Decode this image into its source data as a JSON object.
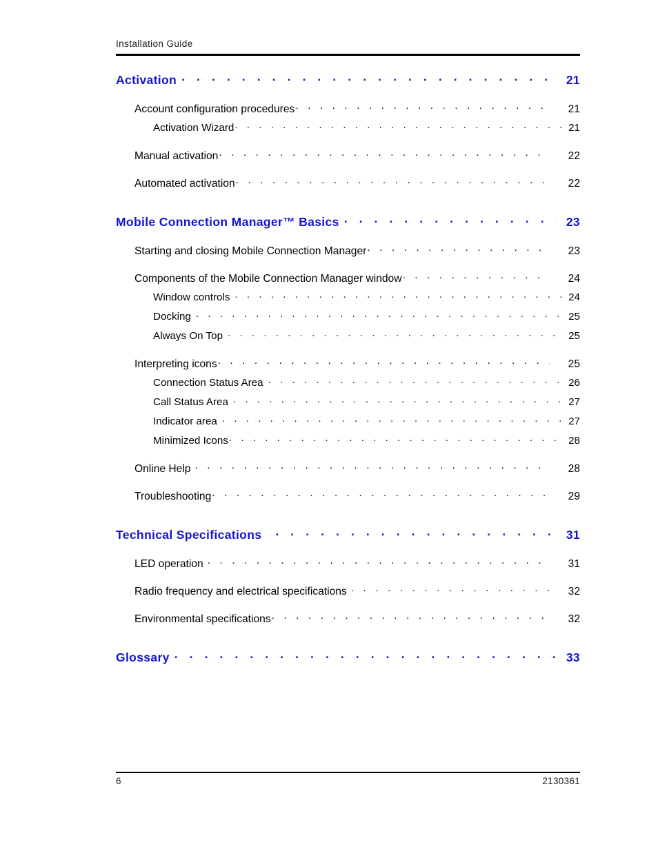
{
  "header": {
    "title": "Installation Guide"
  },
  "footer": {
    "page_number": "6",
    "document_number": "2130361"
  },
  "toc": {
    "sections": [
      {
        "heading": {
          "label": "Activation",
          "page": "21",
          "extra_gap": false
        },
        "entries": [
          {
            "level": 1,
            "label": "Account configuration procedures",
            "page": "21",
            "pad": false
          },
          {
            "level": 2,
            "label": "Activation Wizard",
            "page": "21",
            "pad": false
          },
          {
            "level": 1,
            "label": "Manual activation",
            "page": "22",
            "pad": false
          },
          {
            "level": 1,
            "label": "Automated activation",
            "page": "22",
            "pad": false
          }
        ]
      },
      {
        "heading": {
          "label": "Mobile Connection Manager™ Basics",
          "page": "23",
          "extra_gap": false
        },
        "entries": [
          {
            "level": 1,
            "label": "Starting and closing Mobile Connection Manager",
            "page": "23",
            "pad": false
          },
          {
            "level": 1,
            "label": "Components of the Mobile Connection Manager window",
            "page": "24",
            "pad": false
          },
          {
            "level": 2,
            "label": "Window controls",
            "page": "24",
            "pad": true
          },
          {
            "level": 2,
            "label": "Docking",
            "page": "25",
            "pad": true
          },
          {
            "level": 2,
            "label": "Always On Top",
            "page": "25",
            "pad": true
          },
          {
            "level": 1,
            "label": "Interpreting icons",
            "page": "25",
            "pad": false
          },
          {
            "level": 2,
            "label": "Connection Status Area",
            "page": "26",
            "pad": true
          },
          {
            "level": 2,
            "label": "Call Status Area",
            "page": "27",
            "pad": true
          },
          {
            "level": 2,
            "label": "Indicator area",
            "page": "27",
            "pad": true
          },
          {
            "level": 2,
            "label": "Minimized Icons",
            "page": "28",
            "pad": false
          },
          {
            "level": 1,
            "label": "Online Help",
            "page": "28",
            "pad": true
          },
          {
            "level": 1,
            "label": "Troubleshooting",
            "page": "29",
            "pad": false
          }
        ]
      },
      {
        "heading": {
          "label": "Technical Specifications",
          "page": "31",
          "extra_gap": true
        },
        "entries": [
          {
            "level": 1,
            "label": "LED operation",
            "page": "31",
            "pad": true
          },
          {
            "level": 1,
            "label": "Radio frequency and electrical specifications",
            "page": "32",
            "pad": true
          },
          {
            "level": 1,
            "label": "Environmental specifications",
            "page": "32",
            "pad": false
          }
        ]
      },
      {
        "heading": {
          "label": "Glossary",
          "page": "33",
          "extra_gap": false
        },
        "entries": []
      }
    ]
  },
  "style": {
    "heading_color": "#1414d2",
    "text_color": "#000000"
  }
}
